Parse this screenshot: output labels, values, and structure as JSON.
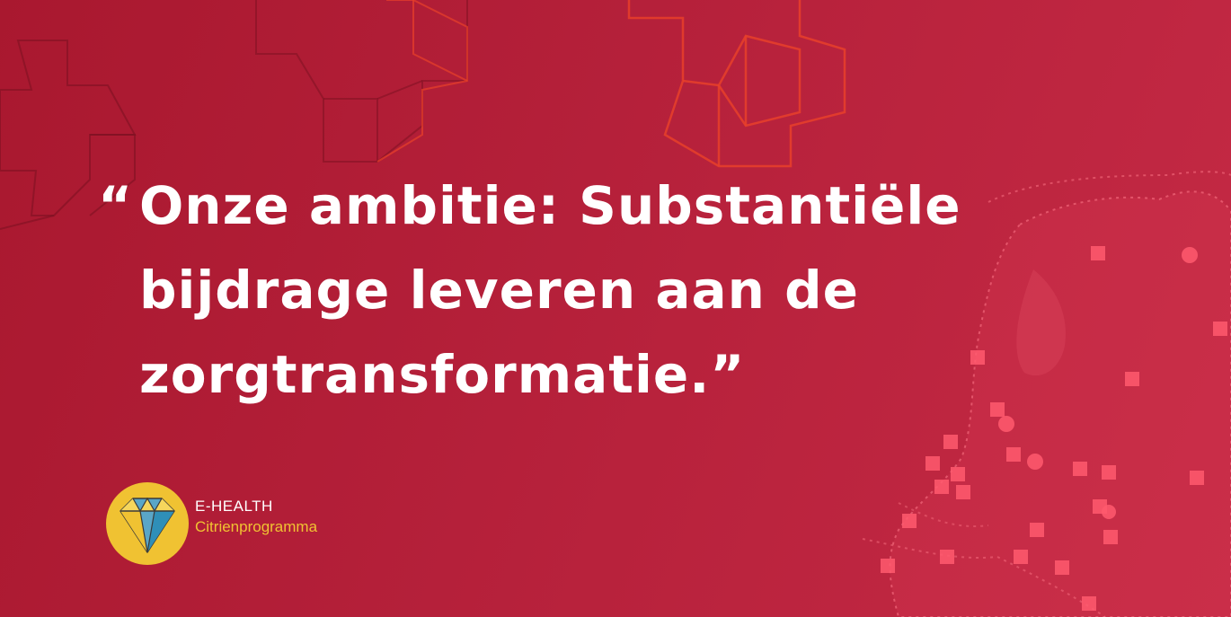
{
  "quote": {
    "open_mark": "“",
    "line1": "Onze ambitie: Substantiële",
    "line2": "bijdrage leveren aan de",
    "line3": "zorgtransformatie.”"
  },
  "logo": {
    "icon": "diamond-icon",
    "title": "E-HEALTH",
    "subtitle": "Citrienprogramma"
  },
  "colors": {
    "background": "#b5203a",
    "text": "#ffffff",
    "accent_yellow": "#f0c232",
    "map_dots": "#ff5a6e",
    "cross_outline": "#e8402a"
  }
}
